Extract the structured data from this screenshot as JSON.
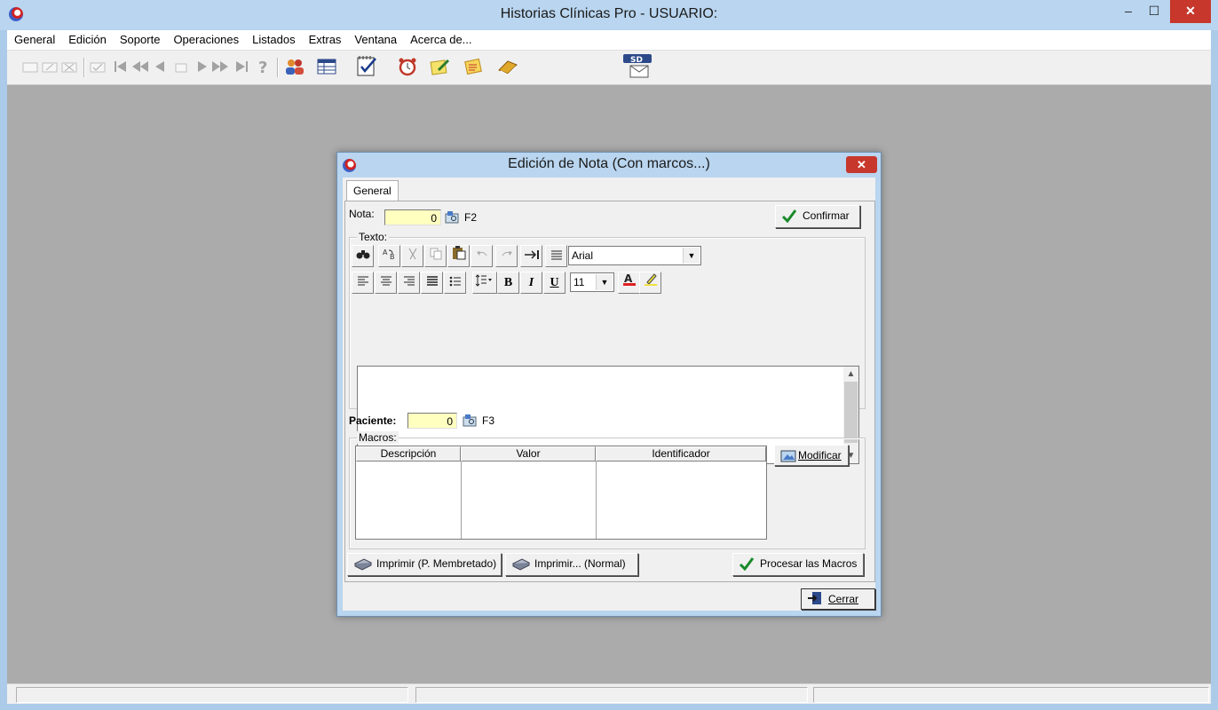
{
  "window": {
    "title": "Historias Clínicas Pro - USUARIO:",
    "controls": {
      "minimize": "–",
      "maximize": "☐",
      "close": "✕"
    }
  },
  "menu": [
    "General",
    "Edición",
    "Soporte",
    "Operaciones",
    "Listados",
    "Extras",
    "Ventana",
    "Acerca de..."
  ],
  "dialog": {
    "title": "Edición de Nota (Con marcos...)",
    "tab": "General",
    "nota_label": "Nota:",
    "nota_value": "0",
    "nota_shortcut": "F2",
    "confirm_label": "Confirmar",
    "texto_group": "Texto:",
    "font_name": "Arial",
    "font_size": "11",
    "format_buttons": {
      "bold": "B",
      "italic": "I",
      "underline": "U"
    },
    "paciente_label": "Paciente:",
    "paciente_value": "0",
    "paciente_shortcut": "F3",
    "macros_group": "Macros:",
    "macros_columns": [
      "Descripción",
      "Valor",
      "Identificador"
    ],
    "modify_label": "Modificar",
    "print_letterhead_label": "Imprimir (P. Membretado)",
    "print_normal_label": "Imprimir... (Normal)",
    "process_macros_label": "Procesar las Macros",
    "close_label": "Cerrar"
  },
  "colors": {
    "title_bar": "#b9d5ef",
    "desktop": "#ababab",
    "yellow_field": "#ffffc0",
    "close_red": "#c7372c"
  }
}
